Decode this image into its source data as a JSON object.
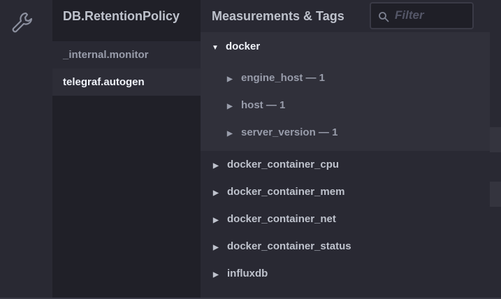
{
  "db_panel": {
    "header": "DB.RetentionPolicy",
    "items": [
      {
        "label": "_internal.monitor",
        "active": false
      },
      {
        "label": "telegraf.autogen",
        "active": true
      }
    ]
  },
  "measurements_panel": {
    "header": "Measurements & Tags",
    "filter": {
      "placeholder": "Filter",
      "value": ""
    },
    "expanded_measurement": {
      "label": "docker",
      "tags": [
        {
          "label": "engine_host — 1"
        },
        {
          "label": "host — 1"
        },
        {
          "label": "server_version — 1"
        }
      ]
    },
    "measurements": [
      {
        "label": "docker_container_cpu"
      },
      {
        "label": "docker_container_mem"
      },
      {
        "label": "docker_container_net"
      },
      {
        "label": "docker_container_status"
      },
      {
        "label": "influxdb"
      }
    ]
  },
  "icons": {
    "sidebar": "wrench-icon",
    "filter": "search-icon",
    "expanded": "caret-down-icon",
    "collapsed": "caret-right-icon"
  },
  "colors": {
    "background": "#1f1f27",
    "panel": "#292933",
    "active_item": "#2d2d37",
    "tag_area": "#30303a",
    "text_bright": "#f0f3fa",
    "text_normal": "#bec2cc",
    "text_muted": "#999dab",
    "placeholder": "#545667"
  }
}
